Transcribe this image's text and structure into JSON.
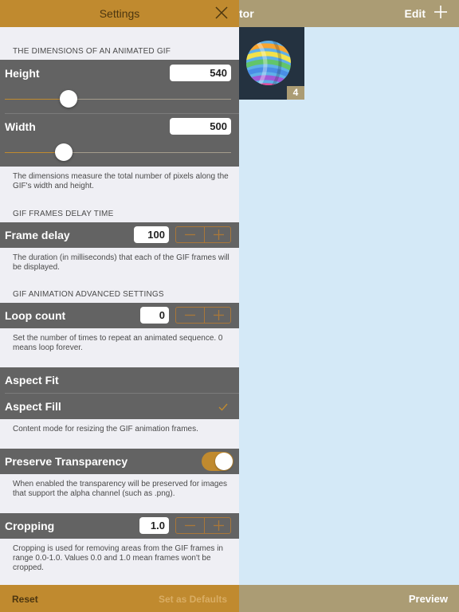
{
  "topbar": {
    "title_fragment": "tor",
    "edit_label": "Edit",
    "add_icon": "plus-icon"
  },
  "gallery": {
    "items": [
      {
        "frame_count": "4"
      }
    ]
  },
  "bottombar": {
    "preview_label": "Preview"
  },
  "settings": {
    "title": "Settings",
    "close_icon": "close-icon",
    "dimensions": {
      "section_title": "THE DIMENSIONS OF AN ANIMATED GIF",
      "height_label": "Height",
      "height_value": "540",
      "height_slider_fraction": 0.28,
      "width_label": "Width",
      "width_value": "500",
      "width_slider_fraction": 0.26,
      "note": "The dimensions measure the total number of pixels along the GIF's width and height."
    },
    "delay": {
      "section_title": "GIF FRAMES DELAY TIME",
      "label": "Frame delay",
      "value": "100",
      "note": "The duration (in milliseconds) that each of the GIF frames will be displayed."
    },
    "advanced": {
      "section_title": "GIF ANIMATION ADVANCED SETTINGS",
      "loop_label": "Loop count",
      "loop_value": "0",
      "loop_note": "Set the number of times to repeat an animated sequence. 0 means loop forever."
    },
    "content_mode": {
      "options": [
        "Aspect Fit",
        "Aspect Fill"
      ],
      "selected": "Aspect Fill",
      "note": "Content mode for resizing the GIF animation frames."
    },
    "transparency": {
      "label": "Preserve Transparency",
      "enabled": true,
      "note": "When enabled the transparency will be preserved for images that support  the alpha channel (such as .png)."
    },
    "cropping": {
      "label": "Cropping",
      "value": "1.0",
      "note": "Cropping is used for removing areas from the GIF frames in range 0.0-1.0. Values 0.0 and 1.0 mean frames won't be cropped."
    },
    "footer": {
      "reset_label": "Reset",
      "defaults_label": "Set as Defaults"
    }
  },
  "colors": {
    "accent": "#c08a2f",
    "bar": "#ab9c74",
    "row_dark": "#636363",
    "background": "#efeff4",
    "canvas": "#d4e9f7"
  }
}
